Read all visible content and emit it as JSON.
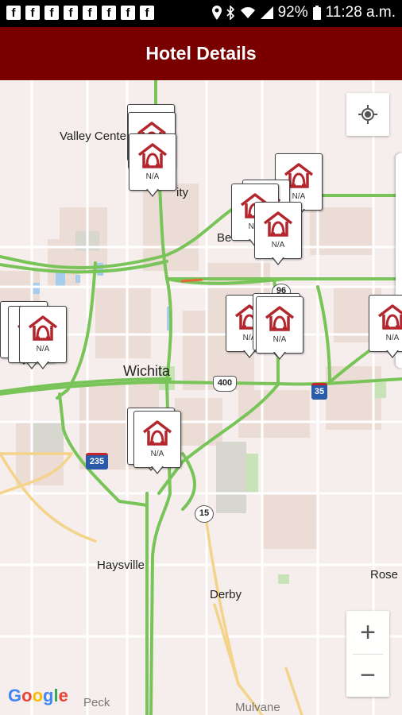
{
  "status_bar": {
    "notification_icons": [
      "facebook-icon",
      "facebook-icon",
      "facebook-icon",
      "facebook-icon",
      "facebook-icon",
      "facebook-icon",
      "facebook-icon",
      "facebook-icon"
    ],
    "battery": "92%",
    "time": "11:28 a.m."
  },
  "app_bar": {
    "title": "Hotel Details"
  },
  "map": {
    "places": {
      "valley_center": "Valley Center",
      "wichita": "Wichita",
      "bel": "Be",
      "haysville": "Haysville",
      "derby": "Derby",
      "rose": "Rose",
      "peck": "Peck",
      "mulvane": "Mulvane",
      "park_city": "ity"
    },
    "shields": {
      "i235": "235",
      "us400": "400",
      "i35": "35",
      "k15": "15",
      "k96": "96"
    },
    "marker_label": "N/A",
    "google_logo": "Google"
  },
  "controls": {
    "zoom_in": "+",
    "zoom_out": "−"
  },
  "colors": {
    "app_bar": "#7a0000",
    "highway": "#7dc95e",
    "logo": "#b3262e"
  }
}
